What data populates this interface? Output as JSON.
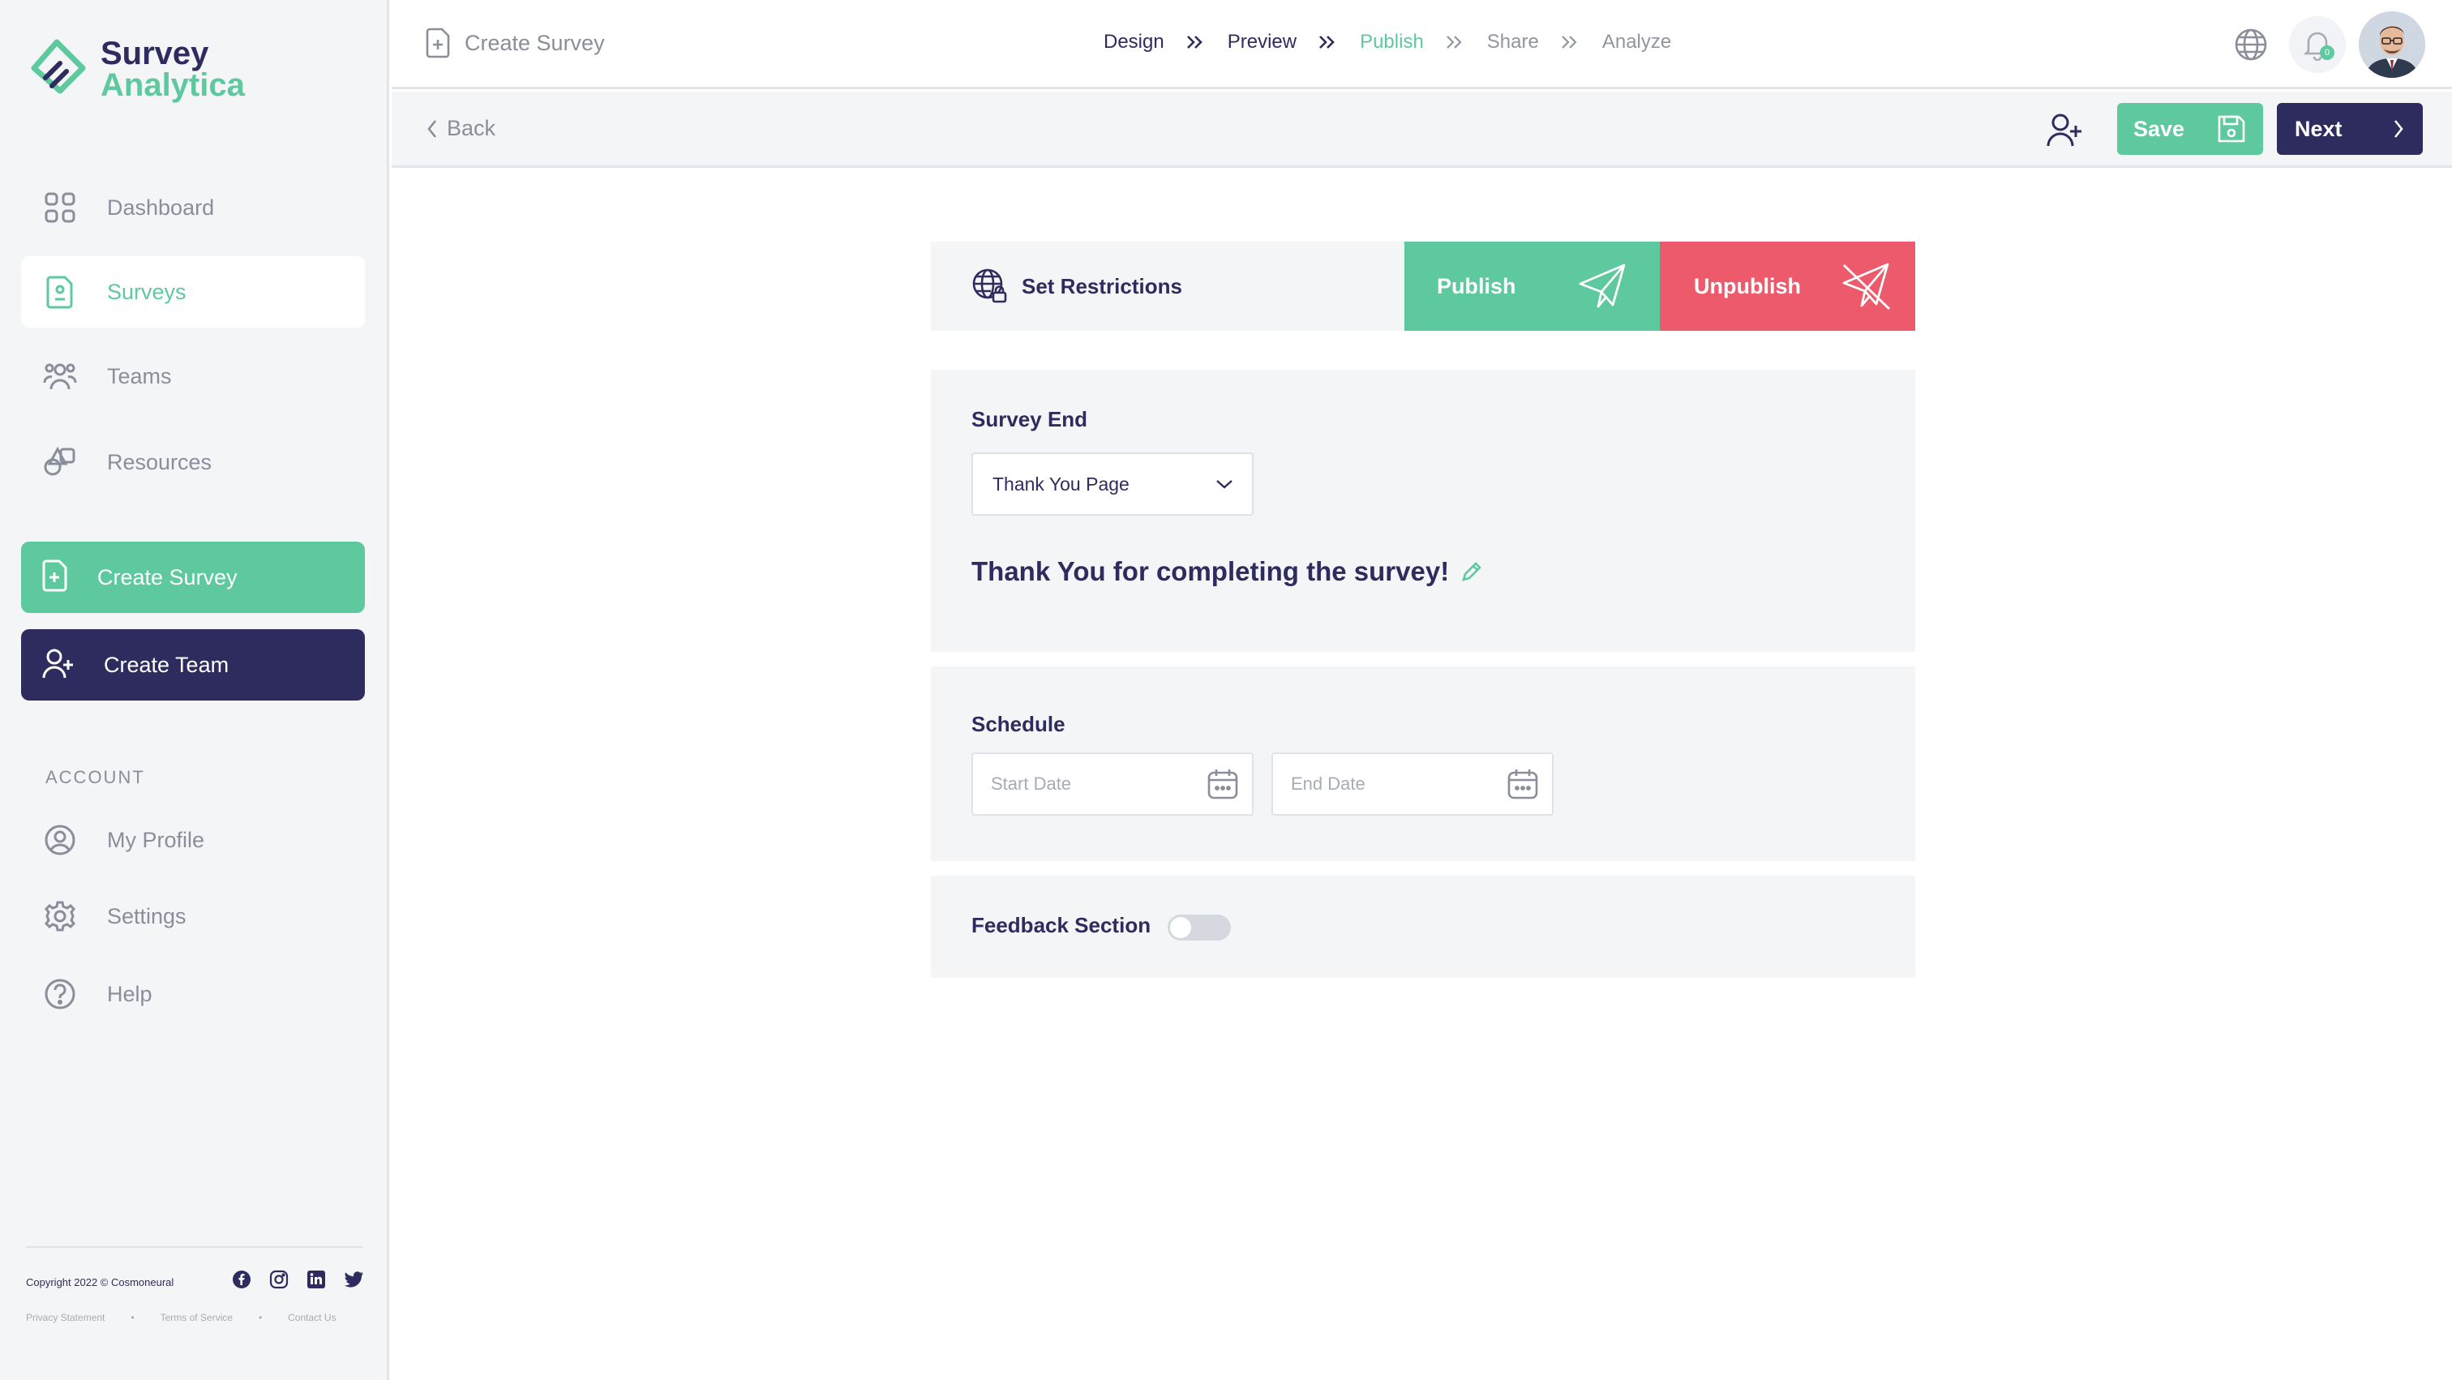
{
  "brand": {
    "line1": "Survey",
    "line2": "Analytica"
  },
  "sidebar": {
    "nav": [
      {
        "label": "Dashboard",
        "icon": "grid-icon"
      },
      {
        "label": "Surveys",
        "icon": "survey-doc-icon",
        "active": true
      },
      {
        "label": "Teams",
        "icon": "team-icon"
      },
      {
        "label": "Resources",
        "icon": "shapes-icon"
      }
    ],
    "create_survey": "Create Survey",
    "create_team": "Create Team",
    "account_label": "ACCOUNT",
    "account": [
      {
        "label": "My Profile",
        "icon": "user-circle-icon"
      },
      {
        "label": "Settings",
        "icon": "gear-icon"
      },
      {
        "label": "Help",
        "icon": "help-icon"
      }
    ],
    "copyright": "Copyright 2022 © Cosmoneural",
    "legal": [
      "Privacy Statement",
      "Terms of Service",
      "Contact Us"
    ],
    "social": [
      "facebook-icon",
      "instagram-icon",
      "linkedin-icon",
      "twitter-icon"
    ]
  },
  "topbar": {
    "title": "Create Survey",
    "steps": [
      {
        "label": "Design",
        "state": "done"
      },
      {
        "label": "Preview",
        "state": "done"
      },
      {
        "label": "Publish",
        "state": "active"
      },
      {
        "label": "Share",
        "state": "future"
      },
      {
        "label": "Analyze",
        "state": "future"
      }
    ],
    "notification_count": "0"
  },
  "subbar": {
    "back": "Back",
    "save": "Save",
    "next": "Next"
  },
  "publish_bar": {
    "restrictions": "Set Restrictions",
    "publish": "Publish",
    "unpublish": "Unpublish"
  },
  "survey_end": {
    "title": "Survey End",
    "selected": "Thank You Page",
    "message": "Thank You for completing the survey!"
  },
  "schedule": {
    "title": "Schedule",
    "start_placeholder": "Start Date",
    "end_placeholder": "End Date"
  },
  "feedback": {
    "title": "Feedback Section",
    "enabled": false
  },
  "colors": {
    "brand_green": "#5ec89f",
    "brand_navy": "#2e2c5e",
    "danger": "#ec5a6b",
    "muted": "#8a8e9b"
  }
}
